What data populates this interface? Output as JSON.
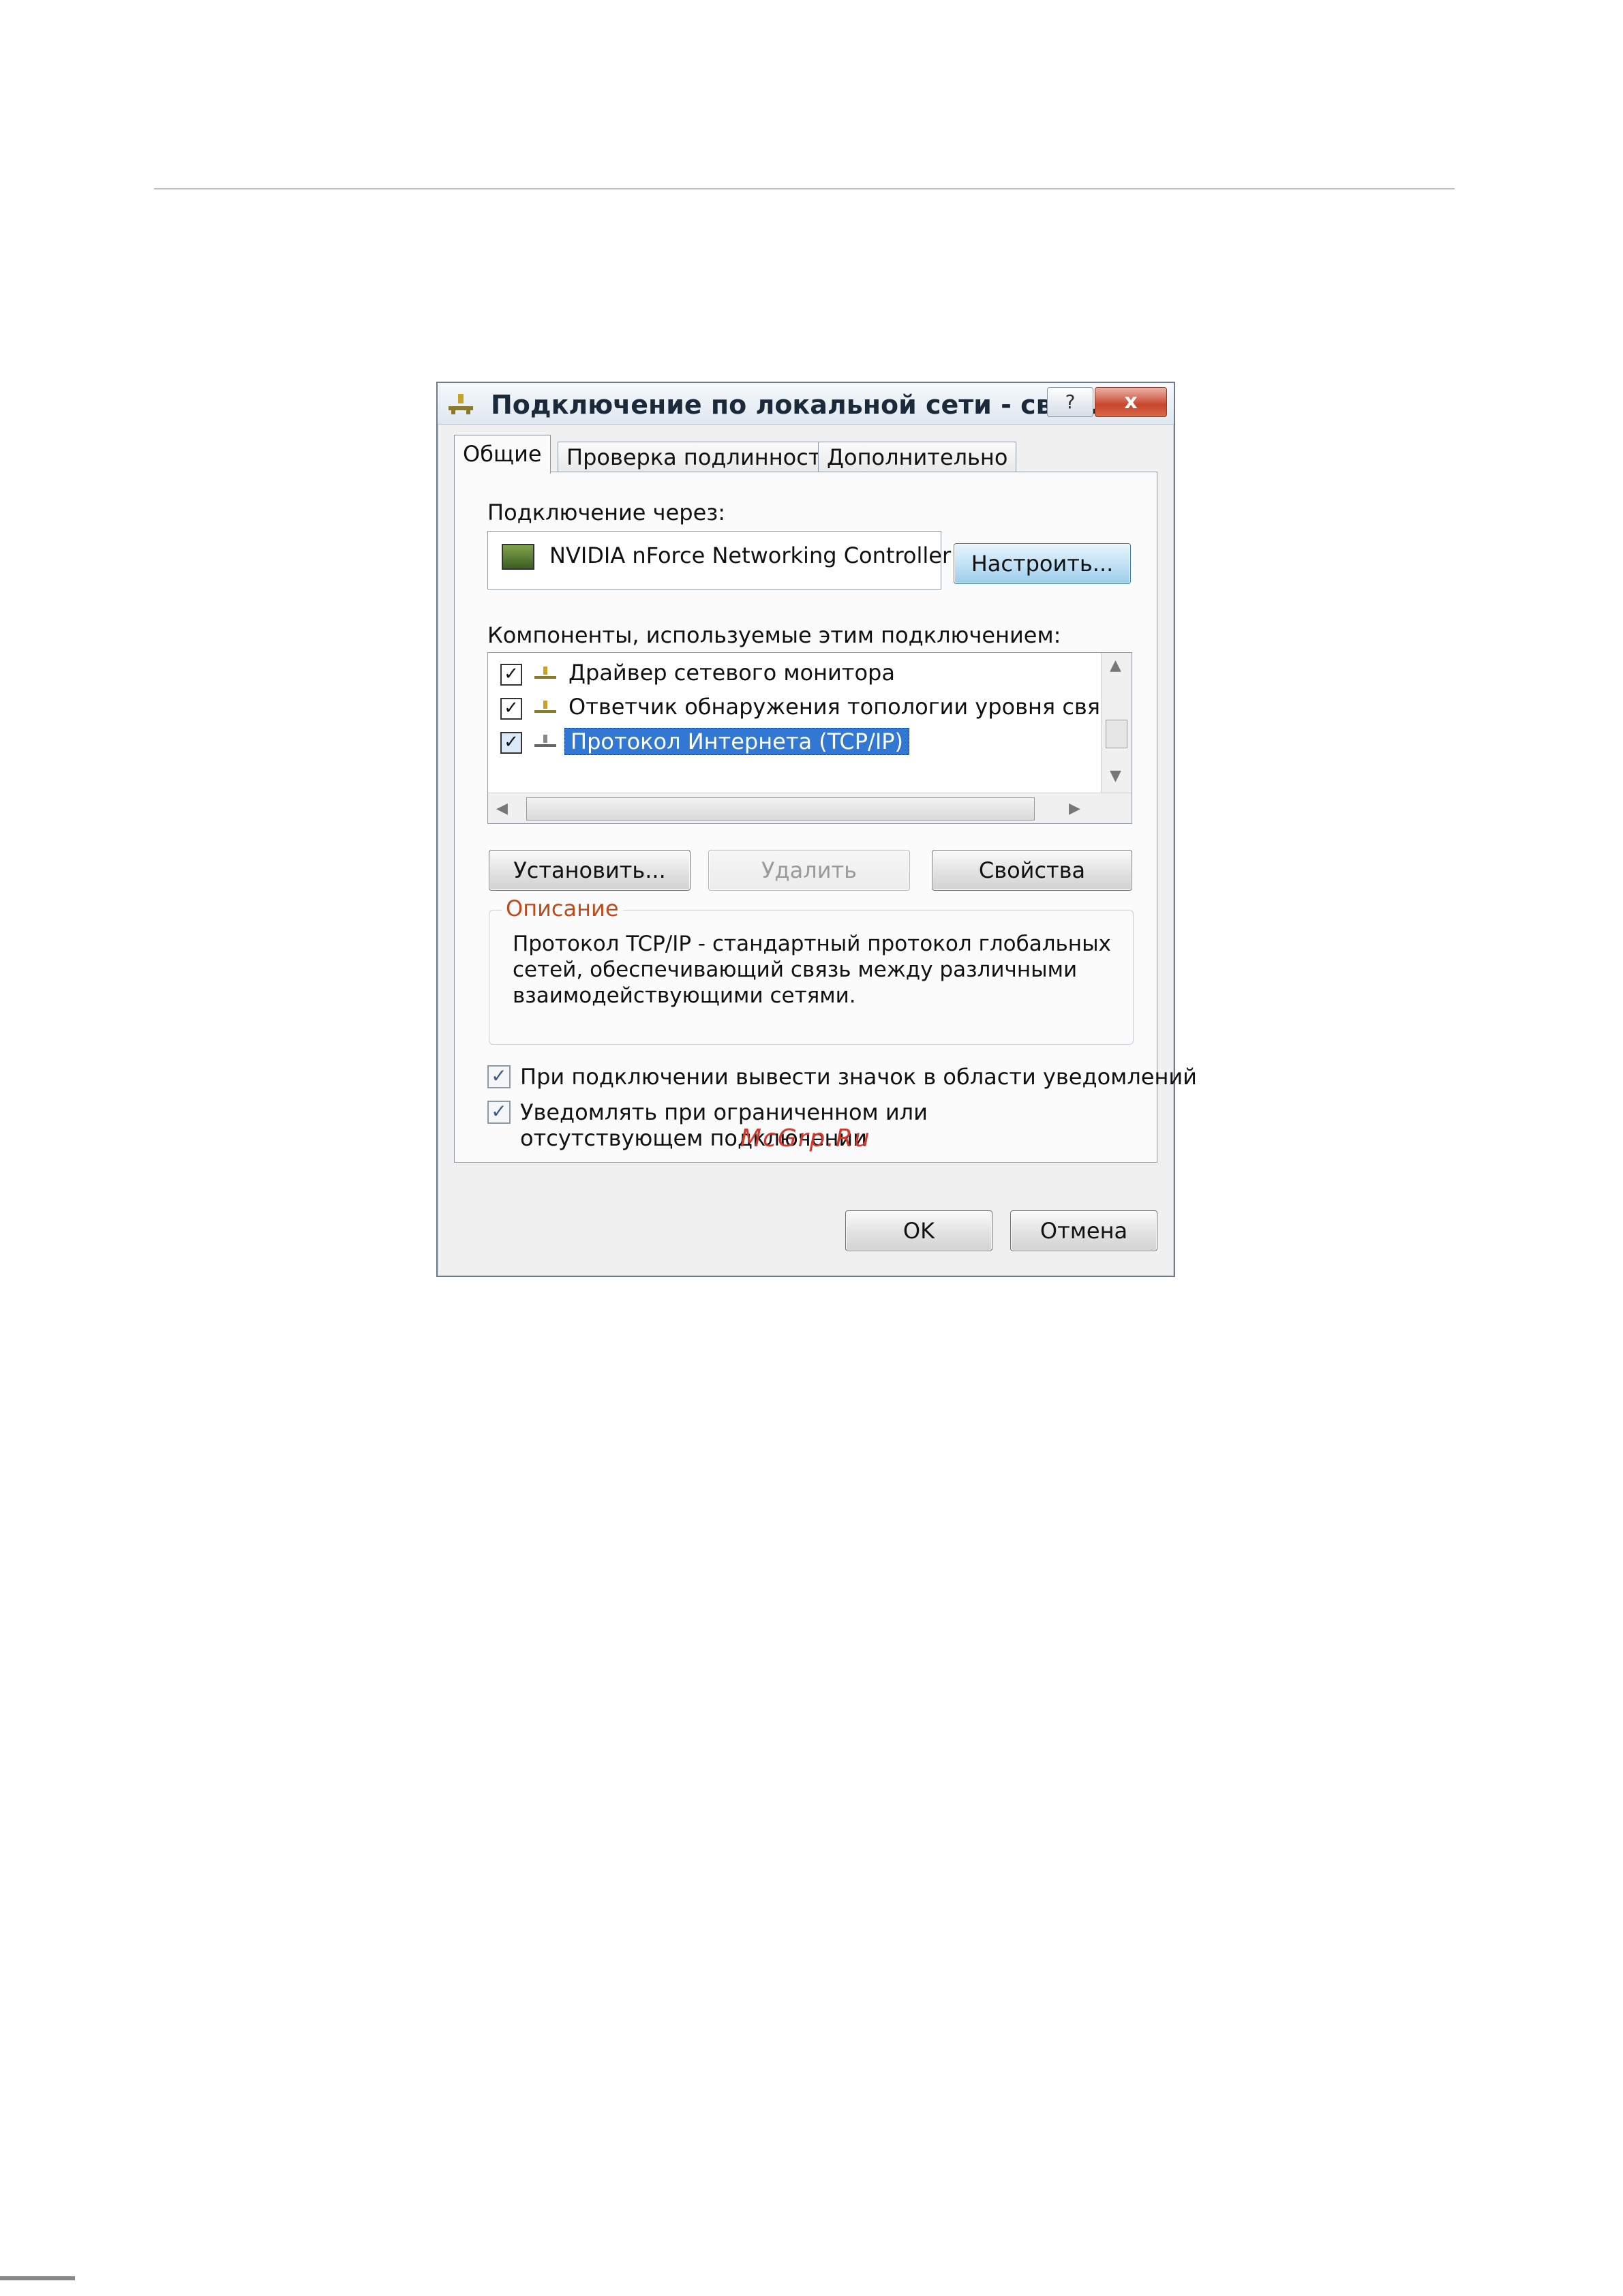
{
  "dialog": {
    "title": "Подключение по локальной сети - сво...",
    "help_label": "?",
    "close_label": "x",
    "tabs": [
      {
        "label": "Общие",
        "active": true
      },
      {
        "label": "Проверка подлинности",
        "active": false
      },
      {
        "label": "Дополнительно",
        "active": false
      }
    ],
    "connect_via_label": "Подключение через:",
    "adapter_name": "NVIDIA nForce Networking Controller",
    "configure_button": "Настроить...",
    "components_label": "Компоненты, используемые этим подключением:",
    "components": [
      {
        "label": "Драйвер сетевого монитора",
        "checked": true,
        "selected": false
      },
      {
        "label": "Ответчик обнаружения топологии уровня связи",
        "checked": true,
        "selected": false
      },
      {
        "label": "Протокол Интернета (TCP/IP)",
        "checked": true,
        "selected": true
      }
    ],
    "install_button": "Установить...",
    "remove_button": "Удалить",
    "properties_button": "Свойства",
    "description_legend": "Описание",
    "description_text": "Протокол TCP/IP - стандартный протокол глобальных сетей, обеспечивающий связь между различными взаимодействующими сетями.",
    "option_tray_icon": "При подключении вывести значок в области уведомлений",
    "option_notify": "Уведомлять при ограниченном или отсутствующем подключении",
    "ok_button": "OK",
    "cancel_button": "Отмена"
  },
  "watermark": "McGrp.Ru",
  "icons": [
    "network-icon",
    "adapter-icon",
    "help-icon",
    "close-icon",
    "checkbox-icon"
  ]
}
